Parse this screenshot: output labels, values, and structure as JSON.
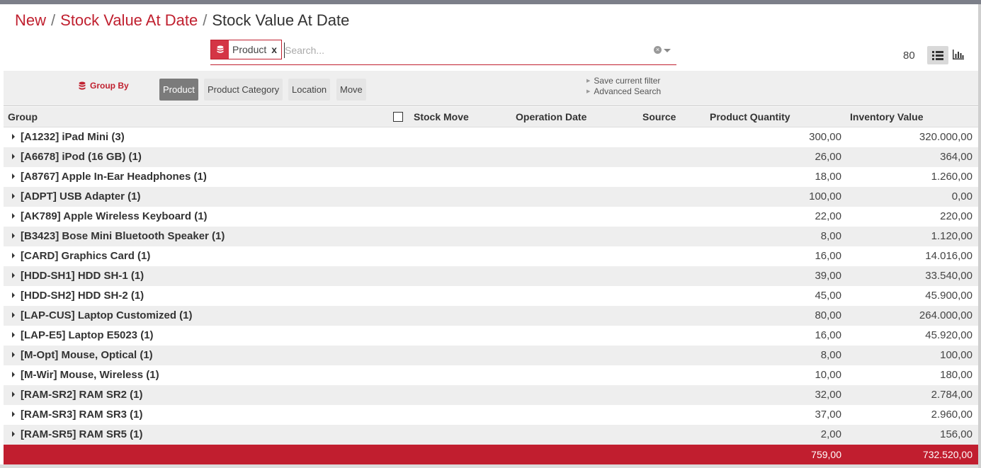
{
  "breadcrumb": {
    "items": [
      "New",
      "Stock Value At Date"
    ],
    "current": "Stock Value At Date",
    "separator": "/"
  },
  "search": {
    "facet_label": "Product",
    "facet_remove": "x",
    "placeholder": "Search..."
  },
  "pager": {
    "value": "80"
  },
  "group_by": {
    "label": "Group By",
    "options": [
      {
        "label": "Product",
        "active": true
      },
      {
        "label": "Product Category",
        "active": false
      },
      {
        "label": "Location",
        "active": false
      },
      {
        "label": "Move",
        "active": false
      }
    ]
  },
  "filters": {
    "save_current_filter": "Save current filter",
    "advanced_search": "Advanced Search"
  },
  "table": {
    "columns": {
      "group": "Group",
      "stock_move": "Stock Move",
      "operation_date": "Operation Date",
      "source": "Source",
      "product_quantity": "Product Quantity",
      "inventory_value": "Inventory Value"
    },
    "rows": [
      {
        "name": "[A1232] iPad Mini (3)",
        "qty": "300,00",
        "value": "320.000,00"
      },
      {
        "name": "[A6678] iPod (16 GB) (1)",
        "qty": "26,00",
        "value": "364,00"
      },
      {
        "name": "[A8767] Apple In-Ear Headphones (1)",
        "qty": "18,00",
        "value": "1.260,00"
      },
      {
        "name": "[ADPT] USB Adapter (1)",
        "qty": "100,00",
        "value": "0,00"
      },
      {
        "name": "[AK789] Apple Wireless Keyboard (1)",
        "qty": "22,00",
        "value": "220,00"
      },
      {
        "name": "[B3423] Bose Mini Bluetooth Speaker (1)",
        "qty": "8,00",
        "value": "1.120,00"
      },
      {
        "name": "[CARD] Graphics Card (1)",
        "qty": "16,00",
        "value": "14.016,00"
      },
      {
        "name": "[HDD-SH1] HDD SH-1 (1)",
        "qty": "39,00",
        "value": "33.540,00"
      },
      {
        "name": "[HDD-SH2] HDD SH-2 (1)",
        "qty": "45,00",
        "value": "45.900,00"
      },
      {
        "name": "[LAP-CUS] Laptop Customized (1)",
        "qty": "80,00",
        "value": "264.000,00"
      },
      {
        "name": "[LAP-E5] Laptop E5023 (1)",
        "qty": "16,00",
        "value": "45.920,00"
      },
      {
        "name": "[M-Opt] Mouse, Optical (1)",
        "qty": "8,00",
        "value": "100,00"
      },
      {
        "name": "[M-Wir] Mouse, Wireless (1)",
        "qty": "10,00",
        "value": "180,00"
      },
      {
        "name": "[RAM-SR2] RAM SR2 (1)",
        "qty": "32,00",
        "value": "2.784,00"
      },
      {
        "name": "[RAM-SR3] RAM SR3 (1)",
        "qty": "37,00",
        "value": "2.960,00"
      },
      {
        "name": "[RAM-SR5] RAM SR5 (1)",
        "qty": "2,00",
        "value": "156,00"
      }
    ],
    "totals": {
      "qty": "759,00",
      "value": "732.520,00"
    }
  },
  "colors": {
    "accent": "#c0202f",
    "footer": "#c11e2f",
    "stripe": "#eeeeee",
    "active_groupby": "#7b7b7b"
  }
}
